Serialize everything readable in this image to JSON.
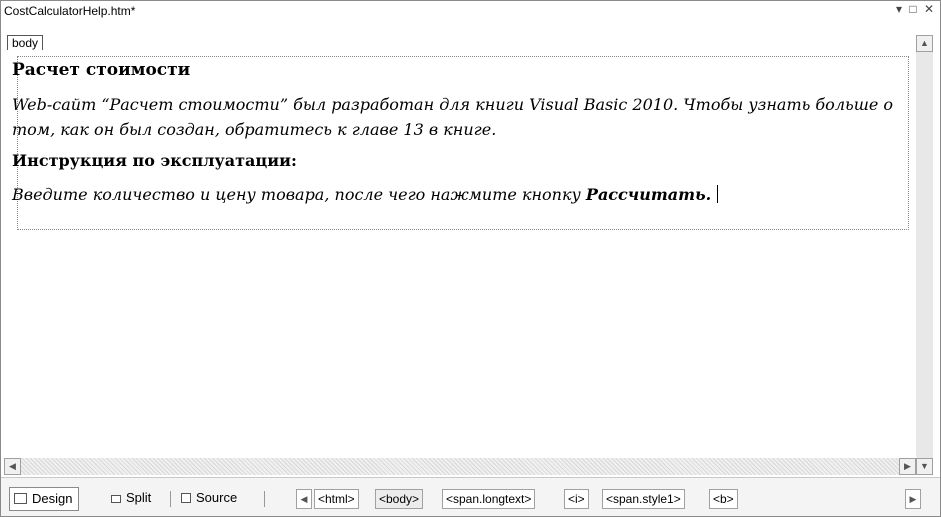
{
  "window": {
    "title": "CostCalculatorHelp.htm*",
    "controls": {
      "dropdown": "▾",
      "restore": "□",
      "close": "✕"
    }
  },
  "editor": {
    "tag_label": "body",
    "heading": "Расчет стоимости",
    "paragraph": "Web-сайт “Расчет стоимости” был разработан для книги Visual Basic 2010. Чтобы узнать больше о том, как он был создан, обратитесь к главе 13 в книге.",
    "subheading": "Инструкция по эксплуатации:",
    "instruction_text": "Введите количество и цену товара, после чего нажмите кнопку",
    "instruction_bold": "Рассчитать."
  },
  "view_tabs": [
    {
      "label": "Design",
      "icon": "design-view-icon",
      "active": true
    },
    {
      "label": "Split",
      "icon": "split-view-icon",
      "active": false
    },
    {
      "label": "Source",
      "icon": "source-view-icon",
      "active": false
    }
  ],
  "tag_path": [
    "<html>",
    "<body>",
    "<span.longtext>",
    "<i>",
    "<span.style1>",
    "<b>"
  ],
  "selected_tag": "<body>"
}
